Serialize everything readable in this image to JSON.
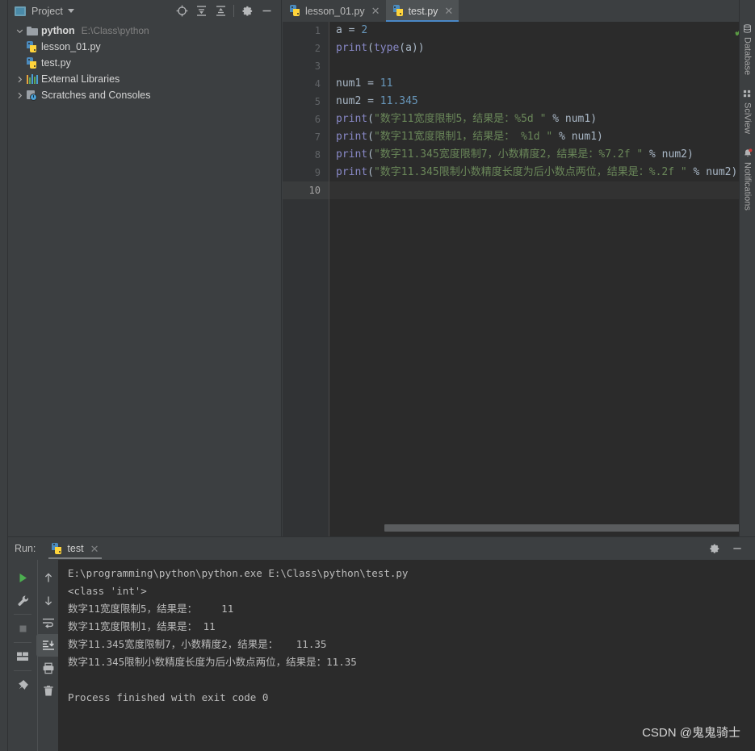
{
  "project": {
    "header_title": "Project",
    "icons": {
      "window_icon": "project-window-icon",
      "dropdown": "chevron-down-icon",
      "locate": "locate-icon",
      "expand_all": "expand-all-icon",
      "collapse_all": "collapse-all-icon",
      "settings": "gear-icon",
      "hide": "minimize-icon"
    },
    "tree": [
      {
        "label": "python",
        "path": "E:\\Class\\python",
        "icon": "folder-icon",
        "expanded": true,
        "level": 0,
        "bold": true
      },
      {
        "label": "lesson_01.py",
        "path": "",
        "icon": "python-file-icon",
        "expanded": null,
        "level": 1,
        "bold": false
      },
      {
        "label": "test.py",
        "path": "",
        "icon": "python-file-icon",
        "expanded": null,
        "level": 1,
        "bold": false
      },
      {
        "label": "External Libraries",
        "path": "",
        "icon": "libraries-icon",
        "expanded": false,
        "level": 0,
        "bold": false
      },
      {
        "label": "Scratches and Consoles",
        "path": "",
        "icon": "scratches-icon",
        "expanded": false,
        "level": 0,
        "bold": false
      }
    ]
  },
  "editor": {
    "tabs": [
      {
        "label": "lesson_01.py",
        "icon": "python-file-icon",
        "active": false
      },
      {
        "label": "test.py",
        "icon": "python-file-icon",
        "active": true
      }
    ],
    "tab_overflow_icon": "more-vertical-icon",
    "inspection_status_icon": "checkmark-icon",
    "inspection_status_color": "#5a9a43",
    "line_numbers": [
      "1",
      "2",
      "3",
      "4",
      "5",
      "6",
      "7",
      "8",
      "9",
      "10"
    ],
    "current_line": 10,
    "lines": [
      [
        {
          "t": "a = ",
          "c": "def"
        },
        {
          "t": "2",
          "c": "num"
        }
      ],
      [
        {
          "t": "print",
          "c": "fn"
        },
        {
          "t": "(",
          "c": "def"
        },
        {
          "t": "type",
          "c": "fn"
        },
        {
          "t": "(a))",
          "c": "def"
        }
      ],
      [
        {
          "t": "",
          "c": "def"
        }
      ],
      [
        {
          "t": "num1 = ",
          "c": "def"
        },
        {
          "t": "11",
          "c": "num"
        }
      ],
      [
        {
          "t": "num2 = ",
          "c": "def"
        },
        {
          "t": "11.345",
          "c": "num"
        }
      ],
      [
        {
          "t": "print",
          "c": "fn"
        },
        {
          "t": "(",
          "c": "def"
        },
        {
          "t": "\"数字11宽度限制5，结果是：%5d \"",
          "c": "str"
        },
        {
          "t": " % num1)",
          "c": "def"
        }
      ],
      [
        {
          "t": "print",
          "c": "fn"
        },
        {
          "t": "(",
          "c": "def"
        },
        {
          "t": "\"数字11宽度限制1，结果是： %1d \"",
          "c": "str"
        },
        {
          "t": " % num1)",
          "c": "def"
        }
      ],
      [
        {
          "t": "print",
          "c": "fn"
        },
        {
          "t": "(",
          "c": "def"
        },
        {
          "t": "\"数字11.345宽度限制7，小数精度2，结果是：%7.2f \"",
          "c": "str"
        },
        {
          "t": " % num2)",
          "c": "def"
        }
      ],
      [
        {
          "t": "print",
          "c": "fn"
        },
        {
          "t": "(",
          "c": "def"
        },
        {
          "t": "\"数字11.345限制小数精度长度为后小数点两位，结果是：%.2f \"",
          "c": "str"
        },
        {
          "t": " % num2)",
          "c": "def"
        }
      ],
      [
        {
          "t": "",
          "c": "def"
        }
      ]
    ],
    "colors": {
      "background": "#2b2b2b",
      "gutter": "#313335",
      "default_text": "#a9b7c6",
      "number": "#6897bb",
      "function": "#8888c6",
      "string": "#6a8759"
    }
  },
  "right_sidebar": [
    {
      "label": "Database",
      "icon": "database-icon"
    },
    {
      "label": "SciView",
      "icon": "sciview-grid-icon"
    },
    {
      "label": "Notifications",
      "icon": "notifications-bell-icon"
    }
  ],
  "run_panel": {
    "title": "Run:",
    "tab_label": "test",
    "tab_icon": "python-file-icon",
    "tab_close_icon": "close-icon",
    "settings_icon": "gear-icon",
    "hide_icon": "minimize-icon",
    "toolbar_left": [
      {
        "name": "rerun-button",
        "icon": "play-icon"
      },
      {
        "name": "edit-configurations-button",
        "icon": "wrench-icon"
      },
      {
        "name": "stop-button",
        "icon": "stop-square-icon"
      },
      {
        "name": "layout-button",
        "icon": "layout-icon"
      },
      {
        "name": "pin-tab-button",
        "icon": "pin-icon"
      }
    ],
    "toolbar_right": [
      {
        "name": "previous-occurrence-button",
        "icon": "arrow-up-icon",
        "selected": false
      },
      {
        "name": "next-occurrence-button",
        "icon": "arrow-down-icon",
        "selected": false
      },
      {
        "name": "soft-wrap-button",
        "icon": "soft-wrap-icon",
        "selected": false
      },
      {
        "name": "scroll-to-end-button",
        "icon": "scroll-to-end-icon",
        "selected": true
      },
      {
        "name": "print-button",
        "icon": "printer-icon",
        "selected": false
      },
      {
        "name": "clear-all-button",
        "icon": "trash-icon",
        "selected": false
      }
    ],
    "console_output": [
      "E:\\programming\\python\\python.exe E:\\Class\\python\\test.py",
      "<class 'int'>",
      "数字11宽度限制5，结果是：    11",
      "数字11宽度限制1，结果是： 11",
      "数字11.345宽度限制7，小数精度2，结果是：   11.35",
      "数字11.345限制小数精度长度为后小数点两位，结果是：11.35",
      "",
      "Process finished with exit code 0"
    ]
  },
  "watermark": "CSDN @鬼鬼骑士"
}
